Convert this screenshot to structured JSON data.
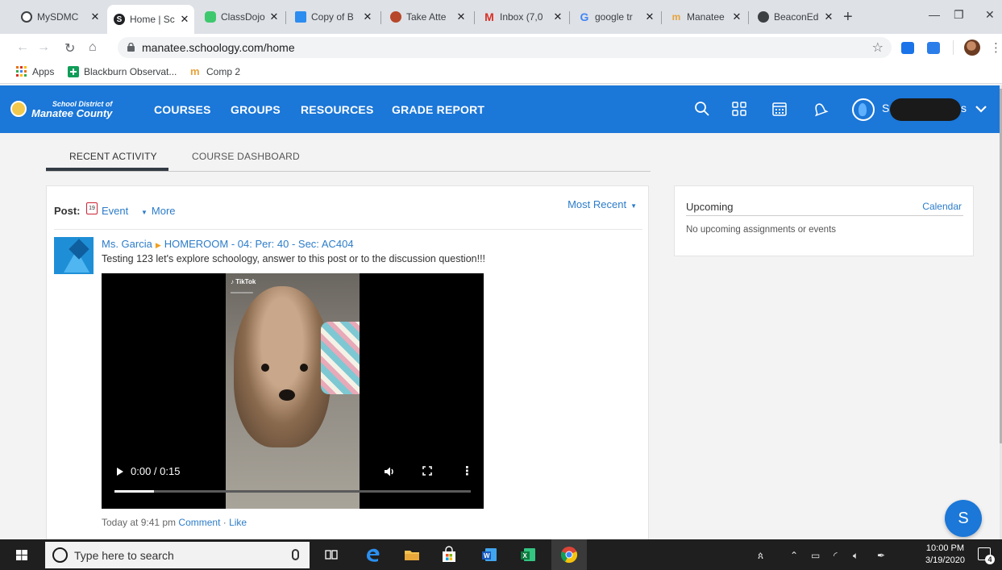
{
  "browser": {
    "tabs": [
      {
        "title": "MySDMC",
        "favicon_color": "#3c4043"
      },
      {
        "title": "Home | Sc",
        "favicon_color": "#202124",
        "active": true
      },
      {
        "title": "ClassDojo",
        "favicon_color": "#3ec86e"
      },
      {
        "title": "Copy of B",
        "favicon_color": "#2d8cf0"
      },
      {
        "title": "Take Atte",
        "favicon_color": "#b7472a"
      },
      {
        "title": "Inbox (7,0",
        "favicon_color": "#d93025"
      },
      {
        "title": "google tr",
        "favicon_color": "#4285f4"
      },
      {
        "title": "Manatee",
        "favicon_color": "#e8a23a"
      },
      {
        "title": "BeaconEd",
        "favicon_color": "#3c4043"
      }
    ],
    "close_glyph": "✕",
    "new_tab_glyph": "+",
    "url": "manatee.schoology.com/home",
    "bookmarks": [
      {
        "label": "Apps",
        "icon": "apps-grid-icon",
        "color": "#e8710a"
      },
      {
        "label": "Blackburn Observat...",
        "icon": "green-plus-icon",
        "color": "#0f9d58"
      },
      {
        "label": "Comp 2",
        "icon": "schoology-icon",
        "color": "#e8a23a"
      }
    ]
  },
  "header": {
    "logo_line1": "School District of",
    "logo_line2": "Manatee County",
    "nav": [
      "COURSES",
      "GROUPS",
      "RESOURCES",
      "GRADE REPORT"
    ],
    "username_initial": "S",
    "username_tail": "s",
    "accent": "#1b77d8"
  },
  "home_tabs": {
    "recent": "RECENT ACTIVITY",
    "dashboard": "COURSE DASHBOARD"
  },
  "feed": {
    "post_label": "Post:",
    "event_label": "Event",
    "calendar_day": "19",
    "more_label": "More",
    "sort_label": "Most Recent",
    "post": {
      "author": "Ms. Garcia",
      "course": "HOMEROOM - 04: Per: 40 - Sec: AC404",
      "body": "Testing 123 let's explore schoology, answer to this post or to the discussion question!!!",
      "video_time": "0:00 / 0:15",
      "video_progress": 0.11,
      "tiktok_label": "TikTok",
      "timestamp": "Today at 9:41 pm",
      "comment_label": "Comment",
      "like_label": "Like"
    }
  },
  "upcoming": {
    "title": "Upcoming",
    "calendar_link": "Calendar",
    "empty": "No upcoming assignments or events"
  },
  "fab_letter": "S",
  "taskbar": {
    "search_placeholder": "Type here to search",
    "time": "10:00 PM",
    "date": "3/19/2020",
    "notification_count": "4"
  }
}
